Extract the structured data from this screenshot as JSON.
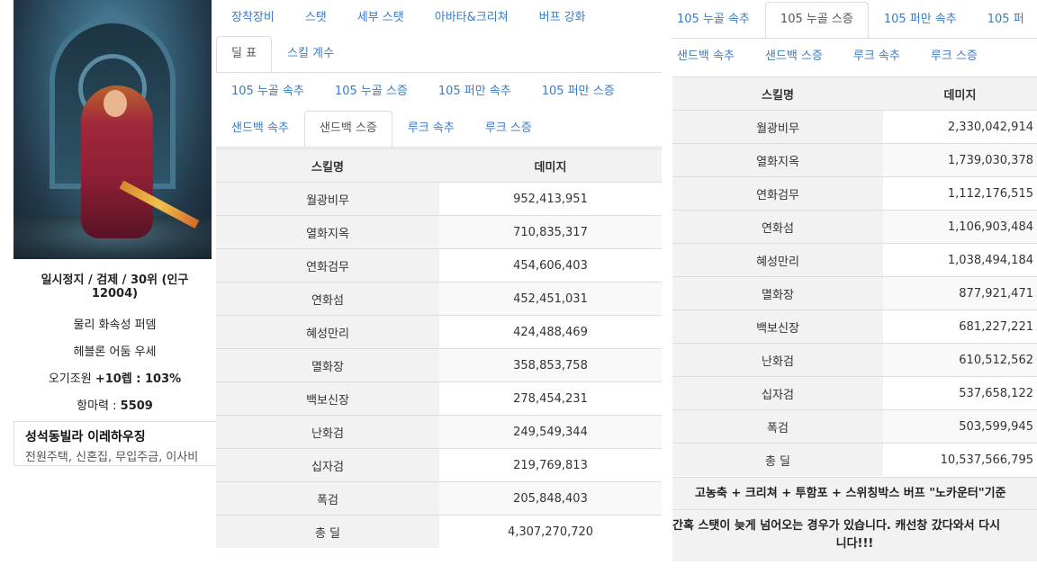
{
  "profile": {
    "line1": "일시정지 / 검제 / 30위 (인구",
    "line2": "12004)",
    "line3": "물리 화속성 퍼뎀",
    "line4": "헤블론 어둠 우세",
    "line5_prefix": "오기조원 ",
    "line5_bold": "+10렙 : 103%",
    "line6_prefix": "항마력 : ",
    "line6_bold": "5509"
  },
  "house": {
    "title": "성석동빌라 이레하우징",
    "subtitle": "전원주택, 신혼집, 무입주금, 이사비"
  },
  "left_panel": {
    "top_tabs": [
      "장착장비",
      "스탯",
      "세부 스탯",
      "아바타&크리쳐",
      "버프 강화"
    ],
    "sub_tabs": [
      "딜 표",
      "스킬 계수"
    ],
    "mode_tabs_row1": [
      "105 누골 속추",
      "105 누골 스증",
      "105 퍼만 속추",
      "105 퍼만 스증"
    ],
    "mode_tabs_row2": [
      "샌드백 속추",
      "샌드백 스증",
      "루크 속추",
      "루크 스증"
    ],
    "table_headers": [
      "스킬명",
      "데미지"
    ],
    "rows": [
      {
        "skill": "월광비무",
        "dmg": "952,413,951"
      },
      {
        "skill": "열화지옥",
        "dmg": "710,835,317"
      },
      {
        "skill": "연화검무",
        "dmg": "454,606,403"
      },
      {
        "skill": "연화섬",
        "dmg": "452,451,031"
      },
      {
        "skill": "혜성만리",
        "dmg": "424,488,469"
      },
      {
        "skill": "멸화장",
        "dmg": "358,853,758"
      },
      {
        "skill": "백보신장",
        "dmg": "278,454,231"
      },
      {
        "skill": "난화검",
        "dmg": "249,549,344"
      },
      {
        "skill": "십자검",
        "dmg": "219,769,813"
      },
      {
        "skill": "폭검",
        "dmg": "205,848,403"
      },
      {
        "skill": "총 딜",
        "dmg": "4,307,270,720"
      }
    ]
  },
  "right_panel": {
    "mode_tabs_row1": [
      "105 누골 속추",
      "105 누골 스증",
      "105 퍼만 속추",
      "105 퍼"
    ],
    "mode_tabs_row2": [
      "샌드백 속추",
      "샌드백 스증",
      "루크 속추",
      "루크 스증"
    ],
    "table_headers": [
      "스킬명",
      "데미지"
    ],
    "rows": [
      {
        "skill": "월광비무",
        "dmg": "2,330,042,914"
      },
      {
        "skill": "열화지옥",
        "dmg": "1,739,030,378"
      },
      {
        "skill": "연화검무",
        "dmg": "1,112,176,515"
      },
      {
        "skill": "연화섬",
        "dmg": "1,106,903,484"
      },
      {
        "skill": "혜성만리",
        "dmg": "1,038,494,184"
      },
      {
        "skill": "멸화장",
        "dmg": "877,921,471"
      },
      {
        "skill": "백보신장",
        "dmg": "681,227,221"
      },
      {
        "skill": "난화검",
        "dmg": "610,512,562"
      },
      {
        "skill": "십자검",
        "dmg": "537,658,122"
      },
      {
        "skill": "폭검",
        "dmg": "503,599,945"
      },
      {
        "skill": "총 딜",
        "dmg": "10,537,566,795"
      }
    ],
    "note1": "고농축 + 크리쳐 + 투함포 + 스위칭박스 버프 \"노카운터\"기준",
    "note2a": "간혹 스탯이 늦게 넘어오는 경우가 있습니다. 캐선창 갔다와서 다시",
    "note2b": "니다!!!"
  },
  "colors": {
    "link": "#3a7bc8",
    "header_bg": "#f2f2f2",
    "border": "#dddddd"
  }
}
